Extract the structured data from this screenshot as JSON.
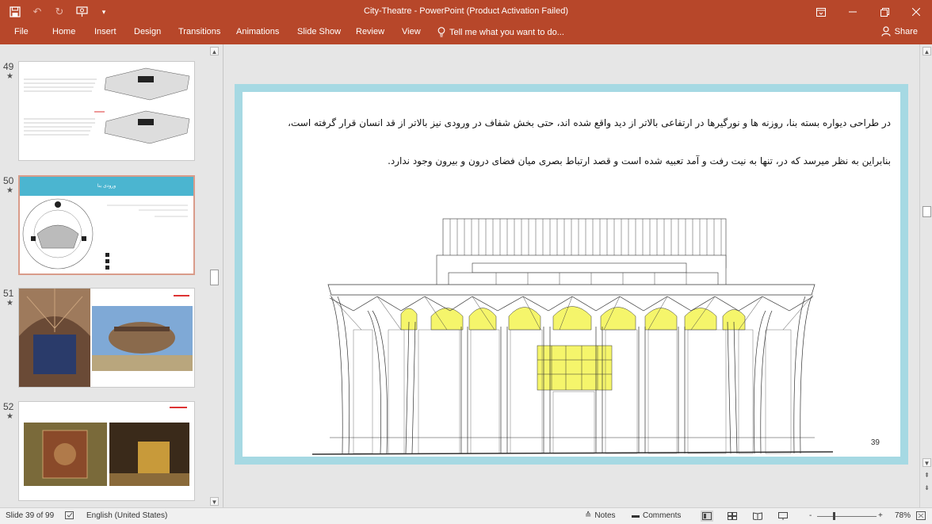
{
  "titlebar": {
    "title": "City-Theatre - PowerPoint (Product Activation Failed)",
    "qat_icons": [
      "save-icon",
      "undo-icon",
      "redo-icon",
      "present-icon",
      "customize-icon"
    ],
    "window_icons": [
      "ribbon-display-icon",
      "minimize-icon",
      "restore-icon",
      "close-icon"
    ]
  },
  "ribbon": {
    "tabs": [
      "File",
      "Home",
      "Insert",
      "Design",
      "Transitions",
      "Animations",
      "Slide Show",
      "Review",
      "View"
    ],
    "tell_me": "Tell me what you want to do...",
    "share": "Share"
  },
  "thumbnails": [
    {
      "number": "49",
      "star": "★",
      "header": "",
      "caption": ""
    },
    {
      "number": "50",
      "star": "★",
      "header": "ورودی بنا",
      "caption": ""
    },
    {
      "number": "51",
      "star": "★",
      "header": "",
      "caption": ""
    },
    {
      "number": "52",
      "star": "★",
      "header": "",
      "caption": ""
    }
  ],
  "slide": {
    "line1": "در طراحی دیواره بسته بنا، روزنه ها و نورگیرها در ارتفاعی بالاتر از دید واقع شده اند، حتی بخش شفاف در ورودی نیز بالاتر از قد انسان قرار گرفته است،",
    "line2": "بنابراین به نظر میرسد که در، تنها به نیت رفت و آمد تعبیه شده است و قصد ارتباط بصری میان فضای درون و بیرون وجود ندارد.",
    "number": "39",
    "colors": {
      "frame": "#a6d9e3",
      "glass": "#f5f56b"
    }
  },
  "statusbar": {
    "slide_info": "Slide 39 of 99",
    "language": "English (United States)",
    "notes": "Notes",
    "comments": "Comments",
    "zoom": "78%",
    "zoom_minus": "-",
    "zoom_plus": "+"
  }
}
